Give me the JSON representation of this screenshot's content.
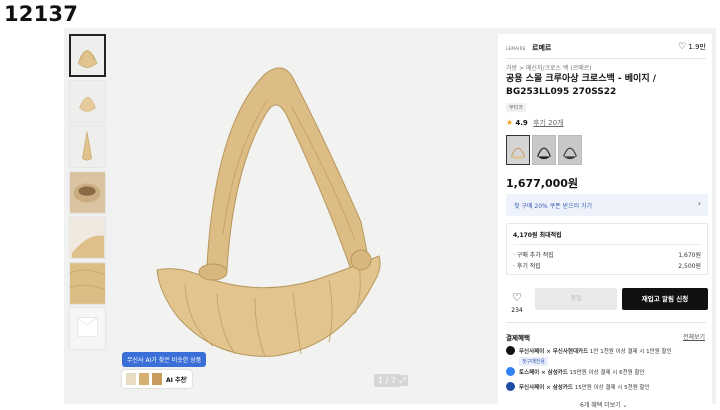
{
  "page_id": "12137",
  "gallery": {
    "counter": "1 / 7",
    "ai_tooltip": "무신사 AI가 찾은 비슷한 상품",
    "ai_button_label": "AI 추천"
  },
  "product": {
    "brand_logo_text": "LEMAIRE",
    "brand_name": "르메르",
    "likes_top": "1.9만",
    "breadcrumb": "가방 > 메신저/크로스 백 (르메르)",
    "title": "공용 스몰 크루아상 크로스백 - 베이지 / BG253LL095 270SS22",
    "badge": "부티크",
    "rating_score": "4.9",
    "rating_reviews": "후기 20개",
    "price": "1,677,000원",
    "accent_star_color": "#f5a623",
    "bag_color": "#e2c58e"
  },
  "promo": {
    "text": "첫 구매 20% 쿠폰 받으러 가기"
  },
  "points": {
    "header": "4,170원 최대적립",
    "rows": [
      {
        "label": "· 구매 추가 적립",
        "value": "1,670원"
      },
      {
        "label": "· 후기 적립",
        "value": "2,500원"
      }
    ]
  },
  "actions": {
    "wish_count": "234",
    "buy_label": "품절",
    "alarm_label": "재입고 알림 신청"
  },
  "benefits": {
    "header": "결제혜택",
    "view_all": "전체보기",
    "items": [
      {
        "text_bold": "무신사페이 × 무신사현대카드",
        "text": " 1만 1천원 이상 결제 시 1만원 할인",
        "tag": "첫구매전용",
        "icon_color": "#111111"
      },
      {
        "text_bold": "토스페이 × 삼성카드",
        "text": " 15만원 이상 결제 시 6천원 할인",
        "tag": "",
        "icon_color": "#3182f6"
      },
      {
        "text_bold": "무신사페이 × 삼성카드",
        "text": " 15만원 이상 결제 시 5천원 할인",
        "tag": "",
        "icon_color": "#1d4ea3"
      }
    ],
    "more": "6개 혜택 더보기 ⌄"
  }
}
